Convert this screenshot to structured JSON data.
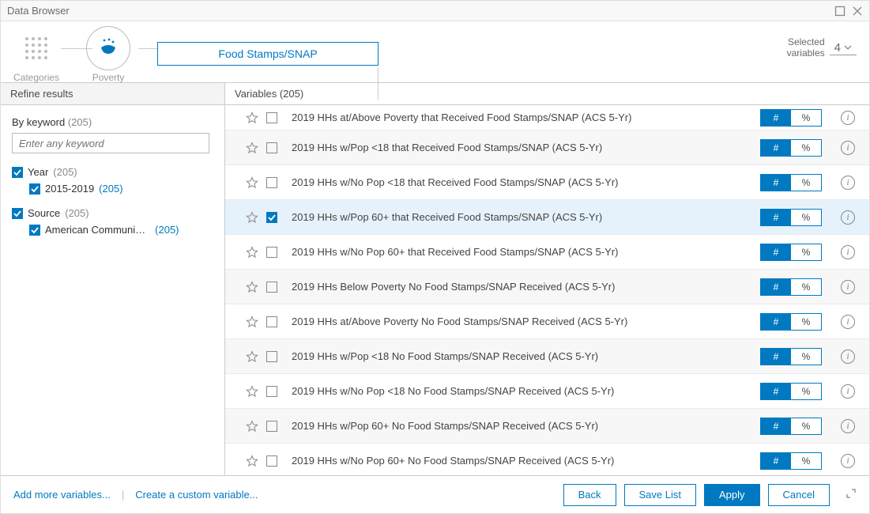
{
  "window": {
    "title": "Data Browser"
  },
  "breadcrumb": {
    "categories_label": "Categories",
    "poverty_label": "Poverty",
    "topic_label": "Food Stamps/SNAP"
  },
  "selected": {
    "label_top": "Selected",
    "label_bottom": "variables",
    "count": "4"
  },
  "columns": {
    "left": "Refine results",
    "right": "Variables (205)"
  },
  "refine": {
    "keyword_label": "By keyword",
    "keyword_count": "(205)",
    "keyword_placeholder": "Enter any keyword",
    "year_label": "Year",
    "year_count": "(205)",
    "year_child_label": "2015-2019",
    "year_child_count": "(205)",
    "source_label": "Source",
    "source_count": "(205)",
    "source_child_label": "American Communi…",
    "source_child_count": "(205)"
  },
  "vars": [
    {
      "label": "2019 HHs at/Above Poverty that Received Food Stamps/SNAP (ACS 5-Yr)",
      "checked": false,
      "alt": false,
      "hash": true
    },
    {
      "label": "2019 HHs w/Pop <18 that Received Food Stamps/SNAP (ACS 5-Yr)",
      "checked": false,
      "alt": true,
      "hash": true
    },
    {
      "label": "2019 HHs w/No Pop <18 that Received Food Stamps/SNAP (ACS 5-Yr)",
      "checked": false,
      "alt": false,
      "hash": true
    },
    {
      "label": "2019 HHs w/Pop 60+ that Received Food Stamps/SNAP (ACS 5-Yr)",
      "checked": true,
      "alt": true,
      "hash": true
    },
    {
      "label": "2019 HHs w/No Pop 60+ that Received Food Stamps/SNAP (ACS 5-Yr)",
      "checked": false,
      "alt": false,
      "hash": true
    },
    {
      "label": "2019 HHs Below Poverty No Food Stamps/SNAP Received (ACS 5-Yr)",
      "checked": false,
      "alt": true,
      "hash": true
    },
    {
      "label": "2019 HHs at/Above Poverty No Food Stamps/SNAP Received (ACS 5-Yr)",
      "checked": false,
      "alt": false,
      "hash": true
    },
    {
      "label": "2019 HHs w/Pop <18 No Food Stamps/SNAP Received (ACS 5-Yr)",
      "checked": false,
      "alt": true,
      "hash": true
    },
    {
      "label": "2019 HHs w/No Pop <18 No Food Stamps/SNAP Received (ACS 5-Yr)",
      "checked": false,
      "alt": false,
      "hash": true
    },
    {
      "label": "2019 HHs w/Pop 60+ No Food Stamps/SNAP Received (ACS 5-Yr)",
      "checked": false,
      "alt": true,
      "hash": true
    },
    {
      "label": "2019 HHs w/No Pop 60+ No Food Stamps/SNAP Received (ACS 5-Yr)",
      "checked": false,
      "alt": false,
      "hash": true
    }
  ],
  "toggle": {
    "hash": "#",
    "pct": "%"
  },
  "footer": {
    "add_more": "Add more variables...",
    "create_custom": "Create a custom variable...",
    "back": "Back",
    "save_list": "Save List",
    "apply": "Apply",
    "cancel": "Cancel"
  }
}
